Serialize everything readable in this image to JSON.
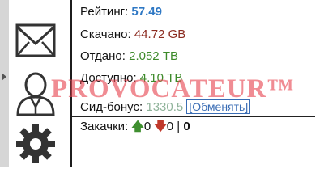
{
  "stats": {
    "rating_label": "Рейтинг:",
    "rating_value": "57.49",
    "downloaded_label": "Скачано:",
    "downloaded_value": "44.72 GB",
    "uploaded_label": "Отдано:",
    "uploaded_value": "2.052 TB",
    "available_label": "Доступно:",
    "available_value": "4.10 TB",
    "bonus_label": "Сид-бонус:",
    "bonus_value": "1330.5",
    "bonus_link": "[Обменять]",
    "downloads_label": "Закачки:",
    "up_count": "0",
    "down_count": "0",
    "separator": "|",
    "total_count": "0"
  },
  "watermark": {
    "text": "PROVOCATEUR™"
  },
  "icons": [
    "envelope-icon",
    "user-icon",
    "gear-icon",
    "expand-arrow-icon"
  ],
  "colors": {
    "rating": "#2f78c4",
    "downloaded": "#8b2b20",
    "uploaded": "#3d8a2a",
    "bonus": "#8fb39a",
    "link": "#3a6db5",
    "watermark": "#e64650"
  }
}
